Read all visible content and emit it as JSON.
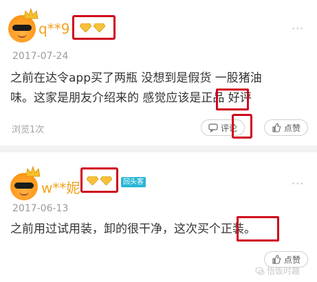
{
  "reviews": [
    {
      "username": "q**9",
      "date": "2017-07-24",
      "text_line1": "之前在达令app买了两瓶 没想到是假货 一股猪油",
      "text_line2": "味。这家是朋友介绍来的 感觉应该是正品 好评",
      "highlight": "正品",
      "views": "浏览1次",
      "comment_label": "评论",
      "like_label": "点赞"
    },
    {
      "username": "w**妮",
      "date": "2017-06-13",
      "tag": "回头客",
      "text_line1": "之前用过试用装，卸的很干净，这次买个正装。",
      "highlight": "正装。",
      "like_label": "点赞"
    }
  ],
  "watermark": "悟饭时趣",
  "colors": {
    "username": "#f2a21c",
    "highlight_box": "#d0021b",
    "tag_bg": "#29b6d6"
  }
}
